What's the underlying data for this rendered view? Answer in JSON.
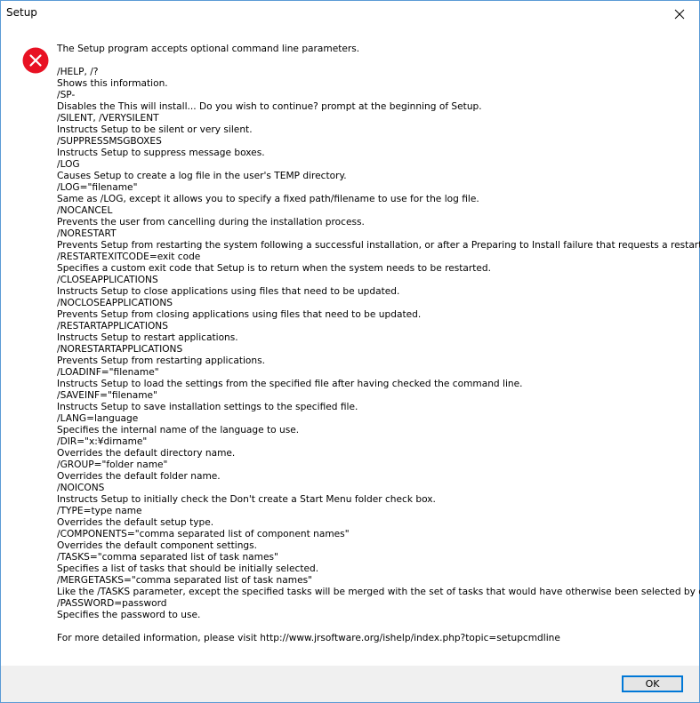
{
  "window": {
    "title": "Setup"
  },
  "icons": {
    "error": "error-x-icon",
    "close": "close-icon"
  },
  "colors": {
    "error_red": "#e81123",
    "accent_blue": "#0078d7",
    "footer_bg": "#f0f0f0"
  },
  "message": {
    "intro": "The Setup program accepts optional command line parameters.",
    "lines": [
      "/HELP, /?",
      "Shows this information.",
      "/SP-",
      "Disables the This will install... Do you wish to continue? prompt at the beginning of Setup.",
      "/SILENT, /VERYSILENT",
      "Instructs Setup to be silent or very silent.",
      "/SUPPRESSMSGBOXES",
      "Instructs Setup to suppress message boxes.",
      "/LOG",
      "Causes Setup to create a log file in the user's TEMP directory.",
      "/LOG=\"filename\"",
      "Same as /LOG, except it allows you to specify a fixed path/filename to use for the log file.",
      "/NOCANCEL",
      "Prevents the user from cancelling during the installation process.",
      "/NORESTART",
      "Prevents Setup from restarting the system following a successful installation, or after a Preparing to Install failure that requests a restart.",
      "/RESTARTEXITCODE=exit code",
      "Specifies a custom exit code that Setup is to return when the system needs to be restarted.",
      "/CLOSEAPPLICATIONS",
      "Instructs Setup to close applications using files that need to be updated.",
      "/NOCLOSEAPPLICATIONS",
      "Prevents Setup from closing applications using files that need to be updated.",
      "/RESTARTAPPLICATIONS",
      "Instructs Setup to restart applications.",
      "/NORESTARTAPPLICATIONS",
      "Prevents Setup from restarting applications.",
      "/LOADINF=\"filename\"",
      "Instructs Setup to load the settings from the specified file after having checked the command line.",
      "/SAVEINF=\"filename\"",
      "Instructs Setup to save installation settings to the specified file.",
      "/LANG=language",
      "Specifies the internal name of the language to use.",
      "/DIR=\"x:¥dirname\"",
      "Overrides the default directory name.",
      "/GROUP=\"folder name\"",
      "Overrides the default folder name.",
      "/NOICONS",
      "Instructs Setup to initially check the Don't create a Start Menu folder check box.",
      "/TYPE=type name",
      "Overrides the default setup type.",
      "/COMPONENTS=\"comma separated list of component names\"",
      "Overrides the default component settings.",
      "/TASKS=\"comma separated list of task names\"",
      "Specifies a list of tasks that should be initially selected.",
      "/MERGETASKS=\"comma separated list of task names\"",
      "Like the /TASKS parameter, except the specified tasks will be merged with the set of tasks that would have otherwise been selected by default.",
      "/PASSWORD=password",
      "Specifies the password to use."
    ],
    "footer_note": "For more detailed information, please visit http://www.jrsoftware.org/ishelp/index.php?topic=setupcmdline"
  },
  "buttons": {
    "ok_label": "OK"
  }
}
